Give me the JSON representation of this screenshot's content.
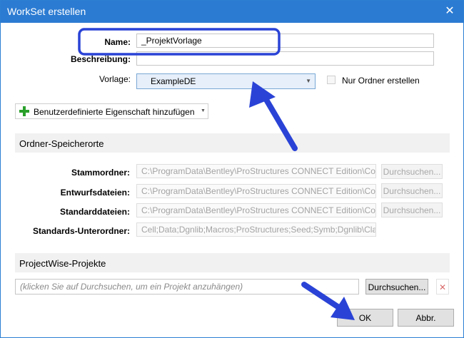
{
  "window": {
    "title": "WorkSet erstellen",
    "close_glyph": "✕"
  },
  "form": {
    "name_label": "Name:",
    "name_value": "_ProjektVorlage",
    "description_label": "Beschreibung:",
    "description_value": "",
    "template_label": "Vorlage:",
    "template_value": "ExampleDE",
    "folder_only_label": "Nur Ordner erstellen",
    "folder_only_checked": false
  },
  "add_property_button": {
    "label": "Benutzerdefinierte Eigenschaft hinzufügen"
  },
  "folders": {
    "heading": "Ordner-Speicherorte",
    "rows": [
      {
        "label": "Stammordner:",
        "value": "C:\\ProgramData\\Bentley\\ProStructures CONNECT Edition\\Co",
        "button": "Durchsuchen..."
      },
      {
        "label": "Entwurfsdateien:",
        "value": "C:\\ProgramData\\Bentley\\ProStructures CONNECT Edition\\Co",
        "button": "Durchsuchen..."
      },
      {
        "label": "Standarddateien:",
        "value": "C:\\ProgramData\\Bentley\\ProStructures CONNECT Edition\\Co",
        "button": "Durchsuchen..."
      },
      {
        "label": "Standards-Unterordner:",
        "value": "Cell;Data;Dgnlib;Macros;ProStructures;Seed;Symb;Dgnlib\\Cla"
      }
    ]
  },
  "projectwise": {
    "heading": "ProjectWise-Projekte",
    "placeholder": "(klicken Sie auf Durchsuchen, um ein Projekt anzuhängen)",
    "browse_button": "Durchsuchen...",
    "clear_glyph": "✕"
  },
  "buttons": {
    "ok": "OK",
    "cancel": "Abbr."
  },
  "colors": {
    "titlebar": "#2b7bd2",
    "annotation": "#2a43d6"
  }
}
